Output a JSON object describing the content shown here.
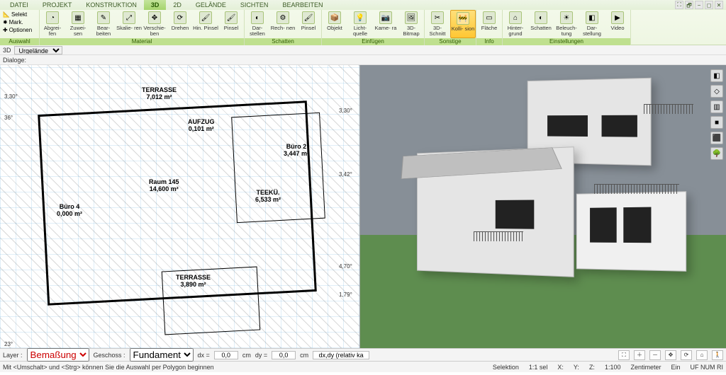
{
  "tabs": [
    "DATEI",
    "PROJEKT",
    "KONSTRUKTION",
    "3D",
    "2D",
    "GELÄNDE",
    "SICHTEN",
    "BEARBEITEN"
  ],
  "active_tab": 3,
  "title_icons": [
    "⛶",
    "🗗",
    "−",
    "◻",
    "✕"
  ],
  "ribbon": {
    "auswahl": {
      "title": "Auswahl",
      "selekt": "Selekt",
      "mark": "Mark.",
      "optionen": "Optionen"
    },
    "material": {
      "title": "Material",
      "buttons": [
        "Abgrei-\nfen",
        "Zuwei-\nsen",
        "Bear-\nbeiten",
        "Skalie-\nren",
        "Verschie-\nben",
        "Drehen",
        "Hin.\nPinsel",
        "Pinsel"
      ]
    },
    "schatten": {
      "title": "Schatten",
      "buttons": [
        "Dar-\nstellen",
        "Rech-\nnen",
        "Pinsel"
      ]
    },
    "einfuegen": {
      "title": "Einfügen",
      "buttons": [
        "Objekt",
        "Licht-\nquelle",
        "Kame-\nra",
        "3D-\nBitmap"
      ]
    },
    "sonstige": {
      "title": "Sonstige",
      "buttons": [
        "3D-\nSchnitt",
        "Kolli-\nsion"
      ]
    },
    "info": {
      "title": "Info",
      "buttons": [
        "Fläche"
      ]
    },
    "einstellungen": {
      "title": "Einstellungen",
      "buttons": [
        "Hinter-\ngrund",
        "Schatten",
        "Beleuch-\ntung",
        "Dar-\nstellung",
        "Video"
      ]
    }
  },
  "secbar": {
    "mode": "3D",
    "layer": "Urgelände"
  },
  "dialoge_label": "Dialoge:",
  "plan": {
    "rooms": [
      {
        "name": "TERRASSE",
        "area": "7,012 m²"
      },
      {
        "name": "Büro 4",
        "area": "0,000 m²"
      },
      {
        "name": "Raum 145",
        "area": "14,600 m²"
      },
      {
        "name": "TEEKÜ.",
        "area": "6,533 m²"
      },
      {
        "name": "TERRASSE",
        "area": "3,890 m²"
      },
      {
        "name": "AUFZUG",
        "area": "0,101 m²"
      },
      {
        "name": "Büro 2",
        "area": "3,447 m²"
      }
    ],
    "dims": [
      "3,30°",
      "36°",
      "23°",
      "3,30°",
      "3,42°",
      "4,70°",
      "1,79°"
    ]
  },
  "rtoolbar_icons": [
    "◧",
    "◇",
    "▥",
    "■",
    "⬛",
    "🌳"
  ],
  "bottom": {
    "layer_label": "Layer :",
    "layer_value": "Bemaßung",
    "geschoss_label": "Geschoss :",
    "geschoss_value": "Fundament",
    "dx_label": "dx =",
    "dx_val": "0,0",
    "dx_unit": "cm",
    "dy_label": "dy =",
    "dy_val": "0,0",
    "dy_unit": "cm",
    "dxdy_hint": "dx,dy (relativ ka",
    "hint": "Mit <Umschalt> und <Strg> können Sie die Auswahl per Polygon beginnen",
    "selektion": "Selektion",
    "sel_count": "1:1 sel",
    "x_label": "X:",
    "y_label": "Y:",
    "z_label": "Z:",
    "scale": "1:100",
    "unit": "Zentimeter",
    "ein": "Ein",
    "kbd": "UF NUM RI"
  }
}
